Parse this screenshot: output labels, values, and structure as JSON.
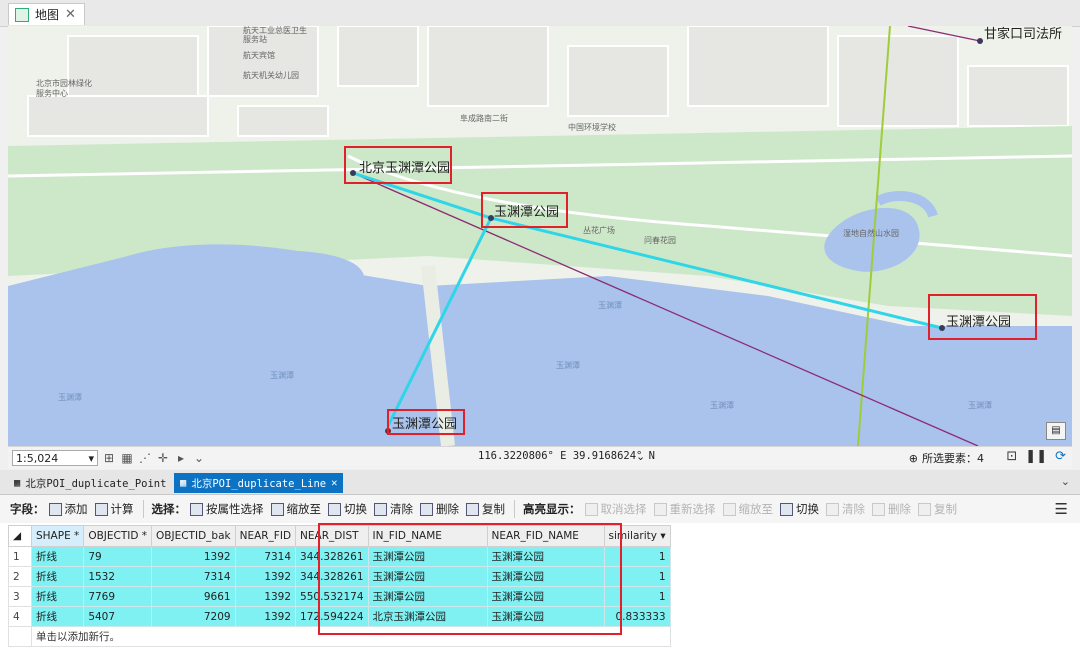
{
  "map_tab": {
    "title": "地图"
  },
  "map": {
    "poi_labels": [
      "北京玉渊潭公园",
      "玉渊潭公园",
      "玉渊潭公园",
      "玉渊潭公园",
      "甘家口司法所"
    ],
    "minor_labels": [
      "航天工业总医卫生",
      "服务站",
      "航天宾馆",
      "航天机关幼儿园",
      "北京市园林绿化",
      "服务中心",
      "阜成路南二街",
      "中国环境学校",
      "丛花广场",
      "问春花园",
      "湿地自然山水园"
    ],
    "water_labels": [
      "玉渊潭",
      "玉渊潭",
      "玉渊潭",
      "玉渊潭",
      "玉渊潭",
      "玉渊潭"
    ]
  },
  "status": {
    "scale": "1:5,024",
    "coords": "116.3220806° E 39.9168624° N",
    "selected_label": "所选要素：4"
  },
  "table_tabs": [
    {
      "label": "北京POI_duplicate_Point"
    },
    {
      "label": "北京POI_duplicate_Line"
    }
  ],
  "toolbar": {
    "fields_label": "字段：",
    "add": "添加",
    "calc": "计算",
    "select_label": "选择：",
    "select_by_attr": "按属性选择",
    "zoom_to": "缩放至",
    "switch": "切换",
    "clear": "清除",
    "delete": "删除",
    "copy": "复制",
    "highlight_label": "高亮显示：",
    "unselect": "取消选择",
    "reselect": "重新选择",
    "zoom_to2": "缩放至",
    "switch2": "切换",
    "clear2": "清除",
    "delete2": "删除",
    "copy2": "复制"
  },
  "table": {
    "columns": [
      "SHAPE *",
      "OBJECTID *",
      "OBJECTID_bak",
      "NEAR_FID",
      "NEAR_DIST",
      "IN_FID_NAME",
      "NEAR_FID_NAME",
      "similarity"
    ],
    "rows": [
      {
        "n": "1",
        "shape": "折线",
        "oid": "79",
        "oid_bak": "1392",
        "near_fid": "7314",
        "near_dist": "344.328261",
        "in_name": "玉渊潭公园",
        "near_name": "玉渊潭公园",
        "sim": "1"
      },
      {
        "n": "2",
        "shape": "折线",
        "oid": "1532",
        "oid_bak": "7314",
        "near_fid": "1392",
        "near_dist": "344.328261",
        "in_name": "玉渊潭公园",
        "near_name": "玉渊潭公园",
        "sim": "1"
      },
      {
        "n": "3",
        "shape": "折线",
        "oid": "7769",
        "oid_bak": "9661",
        "near_fid": "1392",
        "near_dist": "550.532174",
        "in_name": "玉渊潭公园",
        "near_name": "玉渊潭公园",
        "sim": "1"
      },
      {
        "n": "4",
        "shape": "折线",
        "oid": "5407",
        "oid_bak": "7209",
        "near_fid": "1392",
        "near_dist": "172.594224",
        "in_name": "北京玉渊潭公园",
        "near_name": "玉渊潭公园",
        "sim": "0.833333"
      }
    ],
    "add_row_hint": "单击以添加新行。"
  },
  "colors": {
    "highlight_row": "#7ff1f3",
    "accent_tab": "#0b72c4",
    "annotation_box": "#e0202a",
    "water": "#a9c3ec"
  }
}
